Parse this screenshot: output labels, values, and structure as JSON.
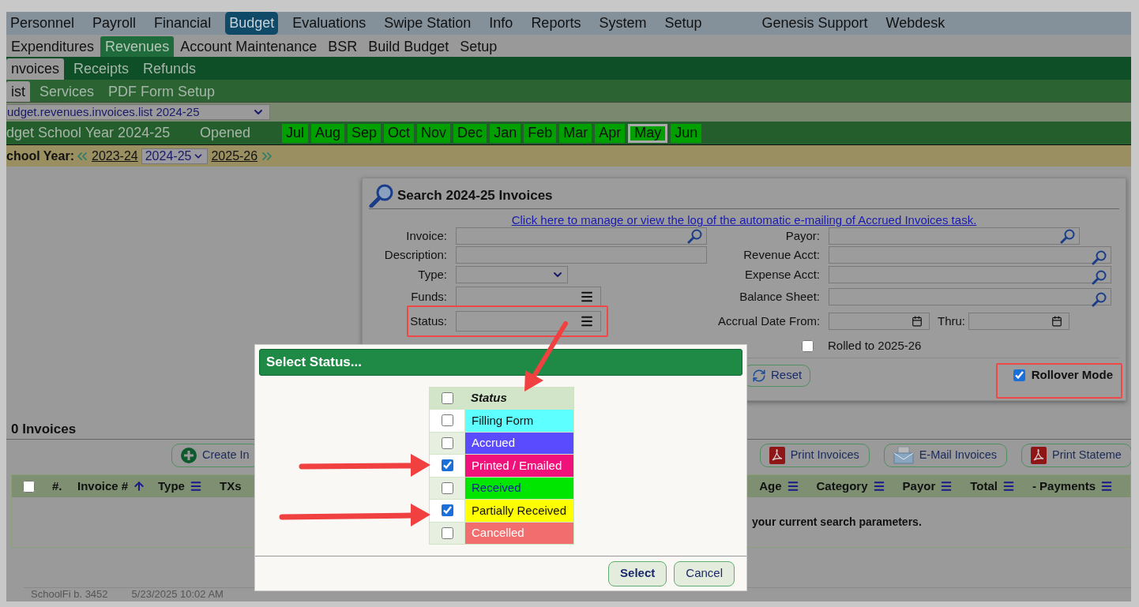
{
  "top_menu": {
    "items": [
      {
        "label": "Personnel",
        "selected": false
      },
      {
        "label": "Payroll",
        "selected": false
      },
      {
        "label": "Financial",
        "selected": false
      },
      {
        "label": "Budget",
        "selected": true
      },
      {
        "label": "Evaluations",
        "selected": false
      },
      {
        "label": "Swipe Station",
        "selected": false
      },
      {
        "label": "Info",
        "selected": false
      },
      {
        "label": "Reports",
        "selected": false
      },
      {
        "label": "System",
        "selected": false
      },
      {
        "label": "Setup",
        "selected": false
      }
    ],
    "links": [
      {
        "label": "Genesis Support"
      },
      {
        "label": "Webdesk"
      }
    ]
  },
  "module_tabs": [
    {
      "label": "Expenditures",
      "selected": false
    },
    {
      "label": "Revenues",
      "selected": true
    },
    {
      "label": "Account Maintenance",
      "selected": false
    },
    {
      "label": "BSR",
      "selected": false
    },
    {
      "label": "Build Budget",
      "selected": false
    },
    {
      "label": "Setup",
      "selected": false
    }
  ],
  "section_tabs": [
    {
      "label": "nvoices",
      "selected": true
    },
    {
      "label": "Receipts",
      "selected": false
    },
    {
      "label": "Refunds",
      "selected": false
    }
  ],
  "view_tabs": [
    {
      "label": "ist",
      "selected": true
    },
    {
      "label": "Services",
      "selected": false
    },
    {
      "label": "PDF Form Setup",
      "selected": false
    }
  ],
  "page_select": {
    "value": "udget.revenues.invoices.list 2024-25"
  },
  "year_bar": {
    "title": "dget School Year 2024-25",
    "status": "Opened",
    "months": [
      {
        "label": "Jul",
        "selected": false
      },
      {
        "label": "Aug",
        "selected": false
      },
      {
        "label": "Sep",
        "selected": false
      },
      {
        "label": "Oct",
        "selected": false
      },
      {
        "label": "Nov",
        "selected": false
      },
      {
        "label": "Dec",
        "selected": false
      },
      {
        "label": "Jan",
        "selected": false
      },
      {
        "label": "Feb",
        "selected": false
      },
      {
        "label": "Mar",
        "selected": false
      },
      {
        "label": "Apr",
        "selected": false
      },
      {
        "label": "May",
        "selected": true
      },
      {
        "label": "Jun",
        "selected": false
      }
    ]
  },
  "school_year": {
    "label": "chool Year:",
    "prev": "2023-24",
    "current": "2024-25",
    "next": "2025-26"
  },
  "search": {
    "title": "Search 2024-25 Invoices",
    "link": "Click here to manage or view the log of the automatic e-mailing of Accrued Invoices task.",
    "left_fields": [
      {
        "label": "Invoice:",
        "kind": "lookup"
      },
      {
        "label": "Description:",
        "kind": "text"
      },
      {
        "label": "Type:",
        "kind": "select"
      },
      {
        "label": "Funds:",
        "kind": "list"
      },
      {
        "label": "Status:",
        "kind": "list"
      }
    ],
    "right_fields": [
      {
        "label": "Payor:",
        "kind": "lookup"
      },
      {
        "label": "Revenue Acct:",
        "kind": "account"
      },
      {
        "label": "Expense Acct:",
        "kind": "account"
      },
      {
        "label": "Balance Sheet:",
        "kind": "account"
      },
      {
        "label": "Accrual Date From:",
        "kind": "date_range",
        "thru": "Thru:"
      }
    ],
    "rolled_to": {
      "label": "Rolled to 2025-26",
      "checked": false
    },
    "reset": "Reset",
    "rollover": {
      "label": "Rollover Mode",
      "checked": true
    }
  },
  "invoices": {
    "title": "0 Invoices",
    "buttons": [
      {
        "label": "Create In",
        "kind": "create"
      },
      {
        "label": "Print Invoices",
        "kind": "pdf"
      },
      {
        "label": "E-Mail Invoices",
        "kind": "email"
      },
      {
        "label": "Print Stateme",
        "kind": "pdf"
      }
    ],
    "select_all": {
      "checked": false
    },
    "leading_columns": [
      {
        "label": "#.",
        "kind": "plain"
      },
      {
        "label": "Invoice #",
        "kind": "sort"
      },
      {
        "label": "Type",
        "kind": "menu"
      },
      {
        "label": "TXs",
        "kind": "plain"
      }
    ],
    "trailing_columns": [
      {
        "label": "Age",
        "kind": "menu"
      },
      {
        "label": "Category",
        "kind": "menu"
      },
      {
        "label": "Payor",
        "kind": "menu"
      },
      {
        "label": "Total",
        "kind": "menu"
      },
      {
        "label": "- Payments",
        "kind": "menu"
      }
    ],
    "message": "your current search parameters."
  },
  "footer": {
    "build": "SchoolFi b. 3452",
    "timestamp": "5/23/2025 10:02 AM"
  },
  "dialog": {
    "title": "Select Status...",
    "header": "Status",
    "select_all": {
      "checked": false
    },
    "statuses": [
      {
        "label": "Filling Form",
        "checked": false,
        "color": "#5effff",
        "kind": "dark"
      },
      {
        "label": "Accrued",
        "checked": false,
        "color": "#5b4bff",
        "kind": "light"
      },
      {
        "label": "Printed / Emailed",
        "checked": true,
        "color": "#f0127a",
        "kind": "light"
      },
      {
        "label": "Received",
        "checked": false,
        "color": "#00e600",
        "kind": "blue"
      },
      {
        "label": "Partially Received",
        "checked": true,
        "color": "#ffff00",
        "kind": "dark"
      },
      {
        "label": "Cancelled",
        "checked": false,
        "color": "#f26d6d",
        "kind": "light"
      }
    ],
    "buttons": [
      {
        "label": "Select",
        "kind": "primary"
      },
      {
        "label": "Cancel",
        "kind": "secondary"
      }
    ]
  }
}
